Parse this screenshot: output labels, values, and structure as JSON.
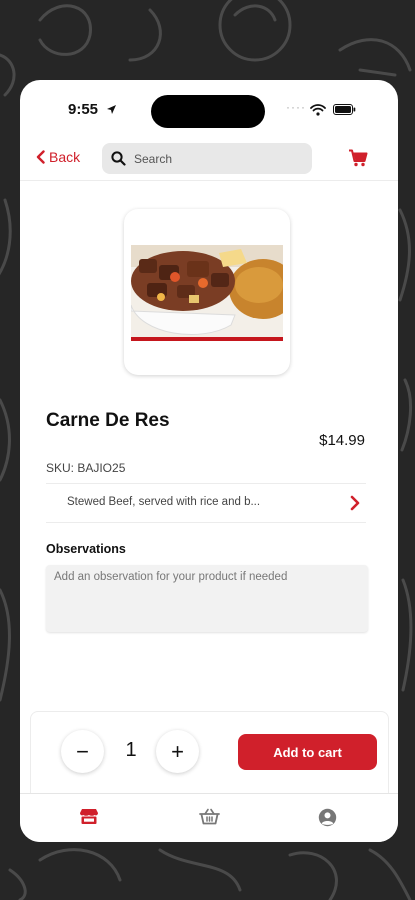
{
  "status_bar": {
    "time": "9:55",
    "dots": "····"
  },
  "header": {
    "back_label": "Back",
    "search_placeholder": "Search"
  },
  "product": {
    "name": "Carne De Res",
    "price": "$14.99",
    "sku": "SKU: BAJIO25",
    "description": "Stewed Beef, served with rice and b...",
    "observations_label": "Observations",
    "observations_placeholder": "Add an observation for your product if needed"
  },
  "cart": {
    "quantity": "1",
    "minus_label": "−",
    "plus_label": "+",
    "add_label": "Add to cart"
  },
  "tabs": [
    {
      "icon": "store-icon"
    },
    {
      "icon": "basket-icon"
    },
    {
      "icon": "profile-icon"
    }
  ],
  "colors": {
    "accent": "#d0202b",
    "background": "#262626",
    "surface": "#ffffff",
    "input_fill": "#e8e8e8"
  }
}
